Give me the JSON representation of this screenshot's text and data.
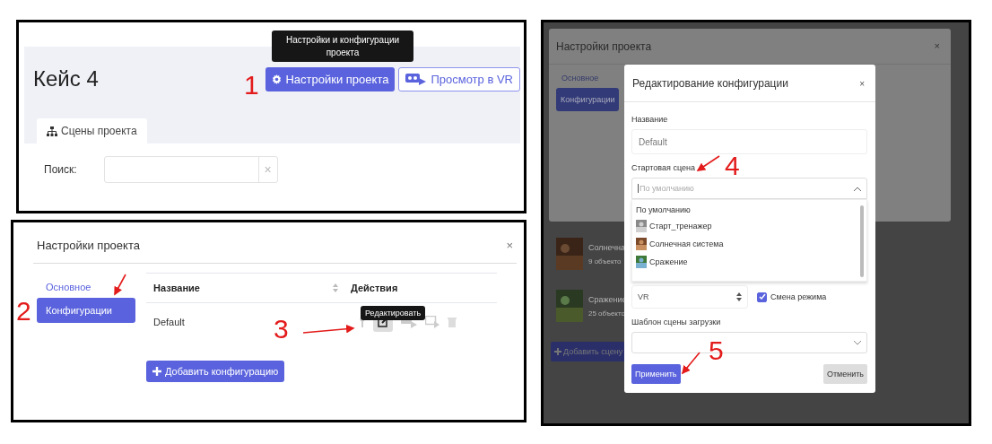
{
  "project_page": {
    "title": "Кейс 4",
    "tooltip": "Настройки и конфигурации проекта",
    "settings_button": "Настройки проекта",
    "vr_button": "Просмотр в VR",
    "tabs": [
      {
        "label": "Сцены проекта",
        "selected": true
      }
    ],
    "search": {
      "label": "Поиск:",
      "clear": "×"
    }
  },
  "settings_dialog": {
    "title": "Настройки проекта",
    "close": "×",
    "nav": [
      {
        "label": "Основное",
        "selected": false
      },
      {
        "label": "Конфигурации",
        "selected": true
      }
    ],
    "table": {
      "columns": [
        "Название",
        "Действия"
      ],
      "rows": [
        {
          "name": "Default"
        }
      ]
    },
    "tooltip": "Редактировать",
    "add_button": "Добавить конфигурацию"
  },
  "edit_view": {
    "background": {
      "title": "Настройки проекта",
      "close": "×",
      "nav": [
        {
          "label": "Основное",
          "selected": false
        },
        {
          "label": "Конфигурации",
          "selected": true
        }
      ],
      "scenes": [
        {
          "name": "Солнечна",
          "count": "9 объекто"
        },
        {
          "name": "Сражение",
          "count": "25 объекто"
        }
      ],
      "add_button": "Добавить сцену"
    },
    "dialog": {
      "title": "Редактирование конфигурации",
      "close": "×",
      "name_label": "Название",
      "name_value": "Default",
      "start_label": "Стартовая сцена",
      "start_placeholder": "По умолчанию",
      "options": [
        {
          "label": "По умолчанию",
          "kind": "plain"
        },
        {
          "label": "Старт_тренажер",
          "kind": "thumb"
        },
        {
          "label": "Солнечная система",
          "kind": "thumb"
        },
        {
          "label": "Сражение",
          "kind": "thumb"
        }
      ],
      "mode": "VR",
      "mode_switch": {
        "label": "Смена режима",
        "checked": true
      },
      "loading_label": "Шаблон сцены загрузки",
      "apply": "Применить",
      "cancel": "Отменить"
    }
  },
  "annotations": [
    {
      "label": "1"
    },
    {
      "label": "2"
    },
    {
      "label": "3"
    },
    {
      "label": "4"
    },
    {
      "label": "5"
    }
  ]
}
